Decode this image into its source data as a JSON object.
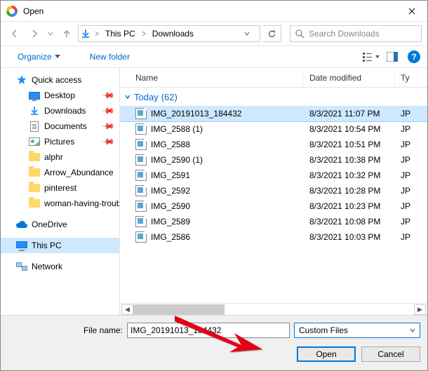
{
  "window": {
    "title": "Open"
  },
  "nav": {
    "crumb1": "This PC",
    "crumb2": "Downloads",
    "search_placeholder": "Search Downloads"
  },
  "toolbar": {
    "organize": "Organize",
    "newfolder": "New folder",
    "help": "?"
  },
  "sidebar": {
    "quick": "Quick access",
    "items": [
      {
        "label": "Desktop"
      },
      {
        "label": "Downloads"
      },
      {
        "label": "Documents"
      },
      {
        "label": "Pictures"
      },
      {
        "label": "alphr"
      },
      {
        "label": "Arrow_Abundance"
      },
      {
        "label": "pinterest"
      },
      {
        "label": "woman-having-trouble"
      }
    ],
    "onedrive": "OneDrive",
    "thispc": "This PC",
    "network": "Network"
  },
  "columns": {
    "name": "Name",
    "date": "Date modified",
    "type": "Ty"
  },
  "group": {
    "label": "Today",
    "count": "(62)"
  },
  "files": [
    {
      "name": "IMG_20191013_184432",
      "date": "8/3/2021 11:07 PM",
      "type": "JP",
      "selected": true
    },
    {
      "name": "IMG_2588 (1)",
      "date": "8/3/2021 10:54 PM",
      "type": "JP"
    },
    {
      "name": "IMG_2588",
      "date": "8/3/2021 10:51 PM",
      "type": "JP"
    },
    {
      "name": "IMG_2590 (1)",
      "date": "8/3/2021 10:38 PM",
      "type": "JP"
    },
    {
      "name": "IMG_2591",
      "date": "8/3/2021 10:32 PM",
      "type": "JP"
    },
    {
      "name": "IMG_2592",
      "date": "8/3/2021 10:28 PM",
      "type": "JP"
    },
    {
      "name": "IMG_2590",
      "date": "8/3/2021 10:23 PM",
      "type": "JP"
    },
    {
      "name": "IMG_2589",
      "date": "8/3/2021 10:08 PM",
      "type": "JP"
    },
    {
      "name": "IMG_2586",
      "date": "8/3/2021 10:03 PM",
      "type": "JP"
    }
  ],
  "footer": {
    "filename_label": "File name:",
    "filename_value": "IMG_20191013_184432",
    "filetype": "Custom Files",
    "open": "Open",
    "cancel": "Cancel"
  }
}
